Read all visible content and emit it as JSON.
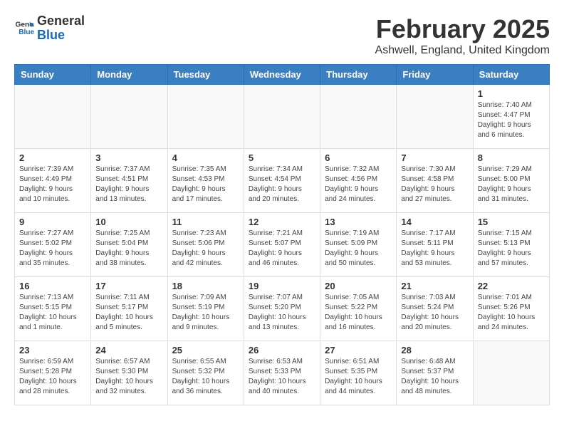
{
  "header": {
    "logo_line1": "General",
    "logo_line2": "Blue",
    "title": "February 2025",
    "subtitle": "Ashwell, England, United Kingdom"
  },
  "weekdays": [
    "Sunday",
    "Monday",
    "Tuesday",
    "Wednesday",
    "Thursday",
    "Friday",
    "Saturday"
  ],
  "weeks": [
    [
      {
        "day": "",
        "info": ""
      },
      {
        "day": "",
        "info": ""
      },
      {
        "day": "",
        "info": ""
      },
      {
        "day": "",
        "info": ""
      },
      {
        "day": "",
        "info": ""
      },
      {
        "day": "",
        "info": ""
      },
      {
        "day": "1",
        "info": "Sunrise: 7:40 AM\nSunset: 4:47 PM\nDaylight: 9 hours and 6 minutes."
      }
    ],
    [
      {
        "day": "2",
        "info": "Sunrise: 7:39 AM\nSunset: 4:49 PM\nDaylight: 9 hours and 10 minutes."
      },
      {
        "day": "3",
        "info": "Sunrise: 7:37 AM\nSunset: 4:51 PM\nDaylight: 9 hours and 13 minutes."
      },
      {
        "day": "4",
        "info": "Sunrise: 7:35 AM\nSunset: 4:53 PM\nDaylight: 9 hours and 17 minutes."
      },
      {
        "day": "5",
        "info": "Sunrise: 7:34 AM\nSunset: 4:54 PM\nDaylight: 9 hours and 20 minutes."
      },
      {
        "day": "6",
        "info": "Sunrise: 7:32 AM\nSunset: 4:56 PM\nDaylight: 9 hours and 24 minutes."
      },
      {
        "day": "7",
        "info": "Sunrise: 7:30 AM\nSunset: 4:58 PM\nDaylight: 9 hours and 27 minutes."
      },
      {
        "day": "8",
        "info": "Sunrise: 7:29 AM\nSunset: 5:00 PM\nDaylight: 9 hours and 31 minutes."
      }
    ],
    [
      {
        "day": "9",
        "info": "Sunrise: 7:27 AM\nSunset: 5:02 PM\nDaylight: 9 hours and 35 minutes."
      },
      {
        "day": "10",
        "info": "Sunrise: 7:25 AM\nSunset: 5:04 PM\nDaylight: 9 hours and 38 minutes."
      },
      {
        "day": "11",
        "info": "Sunrise: 7:23 AM\nSunset: 5:06 PM\nDaylight: 9 hours and 42 minutes."
      },
      {
        "day": "12",
        "info": "Sunrise: 7:21 AM\nSunset: 5:07 PM\nDaylight: 9 hours and 46 minutes."
      },
      {
        "day": "13",
        "info": "Sunrise: 7:19 AM\nSunset: 5:09 PM\nDaylight: 9 hours and 50 minutes."
      },
      {
        "day": "14",
        "info": "Sunrise: 7:17 AM\nSunset: 5:11 PM\nDaylight: 9 hours and 53 minutes."
      },
      {
        "day": "15",
        "info": "Sunrise: 7:15 AM\nSunset: 5:13 PM\nDaylight: 9 hours and 57 minutes."
      }
    ],
    [
      {
        "day": "16",
        "info": "Sunrise: 7:13 AM\nSunset: 5:15 PM\nDaylight: 10 hours and 1 minute."
      },
      {
        "day": "17",
        "info": "Sunrise: 7:11 AM\nSunset: 5:17 PM\nDaylight: 10 hours and 5 minutes."
      },
      {
        "day": "18",
        "info": "Sunrise: 7:09 AM\nSunset: 5:19 PM\nDaylight: 10 hours and 9 minutes."
      },
      {
        "day": "19",
        "info": "Sunrise: 7:07 AM\nSunset: 5:20 PM\nDaylight: 10 hours and 13 minutes."
      },
      {
        "day": "20",
        "info": "Sunrise: 7:05 AM\nSunset: 5:22 PM\nDaylight: 10 hours and 16 minutes."
      },
      {
        "day": "21",
        "info": "Sunrise: 7:03 AM\nSunset: 5:24 PM\nDaylight: 10 hours and 20 minutes."
      },
      {
        "day": "22",
        "info": "Sunrise: 7:01 AM\nSunset: 5:26 PM\nDaylight: 10 hours and 24 minutes."
      }
    ],
    [
      {
        "day": "23",
        "info": "Sunrise: 6:59 AM\nSunset: 5:28 PM\nDaylight: 10 hours and 28 minutes."
      },
      {
        "day": "24",
        "info": "Sunrise: 6:57 AM\nSunset: 5:30 PM\nDaylight: 10 hours and 32 minutes."
      },
      {
        "day": "25",
        "info": "Sunrise: 6:55 AM\nSunset: 5:32 PM\nDaylight: 10 hours and 36 minutes."
      },
      {
        "day": "26",
        "info": "Sunrise: 6:53 AM\nSunset: 5:33 PM\nDaylight: 10 hours and 40 minutes."
      },
      {
        "day": "27",
        "info": "Sunrise: 6:51 AM\nSunset: 5:35 PM\nDaylight: 10 hours and 44 minutes."
      },
      {
        "day": "28",
        "info": "Sunrise: 6:48 AM\nSunset: 5:37 PM\nDaylight: 10 hours and 48 minutes."
      },
      {
        "day": "",
        "info": ""
      }
    ]
  ]
}
